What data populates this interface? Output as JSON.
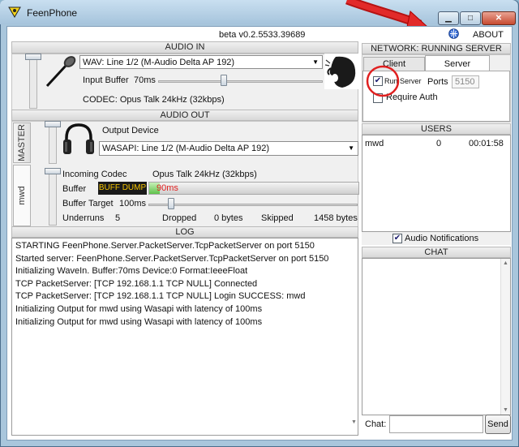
{
  "window": {
    "title": "FeenPhone",
    "minimize": "▁",
    "maximize": "□",
    "close": "✕"
  },
  "header": {
    "version": "beta v0.2.5533.39689",
    "about_label": "ABOUT",
    "about_icon": "globe-icon"
  },
  "audio_in": {
    "title": "AUDIO IN",
    "device": "WAV: Line 1/2 (M-Audio Delta AP 192)",
    "input_buffer_label": "Input Buffer",
    "input_buffer_value": "70ms",
    "codec": "CODEC: Opus Talk 24kHz (32kbps)"
  },
  "audio_out": {
    "title": "AUDIO OUT",
    "tab_master": "MASTER",
    "tab_user": "mwd",
    "output_device_label": "Output Device",
    "output_device": "WASAPI: Line 1/2 (M-Audio Delta AP 192)",
    "incoming_codec_label": "Incoming Codec",
    "incoming_codec_value": "Opus Talk 24kHz (32kbps)",
    "buffer_label": "Buffer",
    "buff_dump_label": "BUFF DUMP",
    "buffer_value": "90ms",
    "buffer_fill_percent": 5,
    "buffer_target_label": "Buffer Target",
    "buffer_target_value": "100ms",
    "underruns_label": "Underruns",
    "underruns_value": "5",
    "dropped_label": "Dropped",
    "dropped_value": "0 bytes",
    "skipped_label": "Skipped",
    "skipped_value": "1458 bytes"
  },
  "log": {
    "title": "LOG",
    "lines": [
      "STARTING FeenPhone.Server.PacketServer.TcpPacketServer on port 5150",
      "Started server: FeenPhone.Server.PacketServer.TcpPacketServer on port 5150",
      "Initializing WaveIn. Buffer:70ms Device:0 Format:IeeeFloat",
      "TCP PacketServer: [TCP 192.168.1.1 TCP NULL] Connected",
      "TCP PacketServer: [TCP 192.168.1.1 TCP NULL] Login SUCCESS: mwd",
      "Initializing Output for mwd using Wasapi with latency of 100ms",
      "Initializing Output for mwd using Wasapi with latency of 100ms"
    ]
  },
  "network": {
    "title": "NETWORK: RUNNING SERVER",
    "tabs": [
      "Client",
      "Server"
    ],
    "run_server_label": "Run Server",
    "run_server_checked": true,
    "ports_label": "Ports",
    "port_value": "5150",
    "require_auth_label": "Require Auth",
    "require_auth_checked": false
  },
  "users": {
    "title": "USERS",
    "rows": [
      {
        "name": "mwd",
        "count": "0",
        "time": "00:01:58"
      }
    ]
  },
  "audio_notifications": {
    "label": "Audio Notifications",
    "checked": true
  },
  "chat": {
    "title": "CHAT",
    "input_label": "Chat:",
    "input_value": "",
    "send_label": "Send"
  },
  "colors": {
    "annotation_red": "#e02020",
    "buff_dump_bg": "#1a1a1a",
    "buff_dump_text": "#f5c400",
    "buffer_value_text": "#e02020"
  }
}
